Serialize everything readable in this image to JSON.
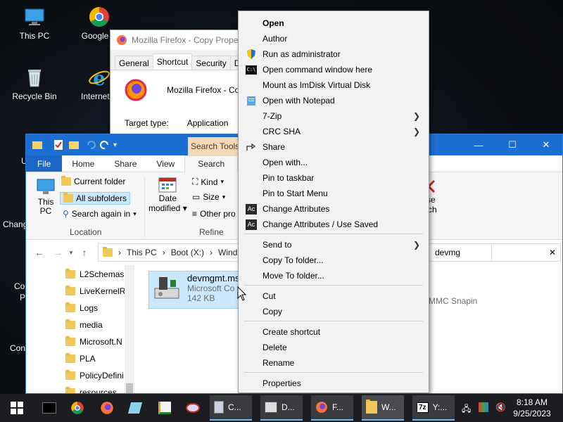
{
  "desktop": {
    "icons": [
      {
        "label": "This PC"
      },
      {
        "label": "Google C"
      },
      {
        "label": "Recycle Bin"
      },
      {
        "label": "Internet E"
      }
    ],
    "side_labels": [
      "U",
      "Chang",
      "Co",
      "P",
      "Con"
    ]
  },
  "properties_window": {
    "title": "Mozilla Firefox - Copy Proper",
    "tabs": [
      "General",
      "Shortcut",
      "Security",
      "Det"
    ],
    "active_tab": "Shortcut",
    "name": "Mozilla Firefox - Copy",
    "target_type_label": "Target type:",
    "target_type_value": "Application"
  },
  "explorer": {
    "search_tools": "Search Tools",
    "ribbon_tabs": [
      "File",
      "Home",
      "Share",
      "View",
      "Search"
    ],
    "ribbon": {
      "this_pc": [
        "This",
        "PC"
      ],
      "current_folder": "Current folder",
      "all_subfolders": "All subfolders",
      "search_again_in": "Search again in",
      "location_group": "Location",
      "date_modified": [
        "Date",
        "modified"
      ],
      "kind": "Kind",
      "size": "Size",
      "other_props": "Other pro",
      "refine_group": "Refine",
      "close_search": [
        "ose",
        "arch"
      ]
    },
    "address": {
      "parts": [
        "This PC",
        "Boot (X:)",
        "Wind"
      ],
      "search_value": "devmg"
    },
    "nav_items": [
      "L2Schemas",
      "LiveKernelR",
      "Logs",
      "media",
      "Microsoft.N",
      "PLA",
      "PolicyDefini",
      "resources"
    ],
    "file": {
      "name": "devmgmt.ms",
      "type": "Microsoft Co",
      "size": "142 KB",
      "detail": "MMC Snapin"
    }
  },
  "context_menu": {
    "items": [
      {
        "label": "Open",
        "bold": true,
        "icon": ""
      },
      {
        "label": "Author",
        "icon": ""
      },
      {
        "label": "Run as administrator",
        "icon": "shield-icon"
      },
      {
        "label": "Open command window here",
        "icon": "cmd-icon"
      },
      {
        "label": "Mount as ImDisk Virtual Disk",
        "icon": ""
      },
      {
        "label": "Open with Notepad",
        "icon": "notepad-icon"
      },
      {
        "label": "7-Zip",
        "icon": "",
        "submenu": true
      },
      {
        "label": "CRC SHA",
        "icon": "",
        "submenu": true
      },
      {
        "label": "Share",
        "icon": "share-icon"
      },
      {
        "label": "Open with...",
        "icon": ""
      },
      {
        "label": "Pin to taskbar",
        "icon": ""
      },
      {
        "label": "Pin to Start Menu",
        "icon": ""
      },
      {
        "label": "Change Attributes",
        "icon": "attributes-icon"
      },
      {
        "label": "Change Attributes / Use Saved",
        "icon": "attributes-icon"
      },
      {
        "label": "Send to",
        "icon": "",
        "submenu": true
      },
      {
        "label": "Copy To folder...",
        "icon": ""
      },
      {
        "label": "Move To folder...",
        "icon": ""
      },
      {
        "label": "Cut",
        "icon": ""
      },
      {
        "label": "Copy",
        "icon": ""
      },
      {
        "label": "Create shortcut",
        "icon": ""
      },
      {
        "label": "Delete",
        "icon": ""
      },
      {
        "label": "Rename",
        "icon": ""
      },
      {
        "label": "Properties",
        "icon": ""
      }
    ],
    "attributes_glyph": "Ac",
    "cmd_glyph": "C:\\"
  },
  "taskbar": {
    "apps": [
      {
        "label": "C..."
      },
      {
        "label": "D..."
      },
      {
        "label": "F..."
      },
      {
        "label": "W..."
      },
      {
        "label": "Y:..."
      }
    ],
    "time": "8:18 AM",
    "date": "9/25/2023",
    "zip_glyph": "7z"
  },
  "colors": {
    "taskbar": "#1c1d20",
    "explorer_title": "#1c6fd1",
    "selection": "#cce8ff",
    "search_tools_tab": "#f6d9b8",
    "menu_background": "#f2f2f2"
  }
}
